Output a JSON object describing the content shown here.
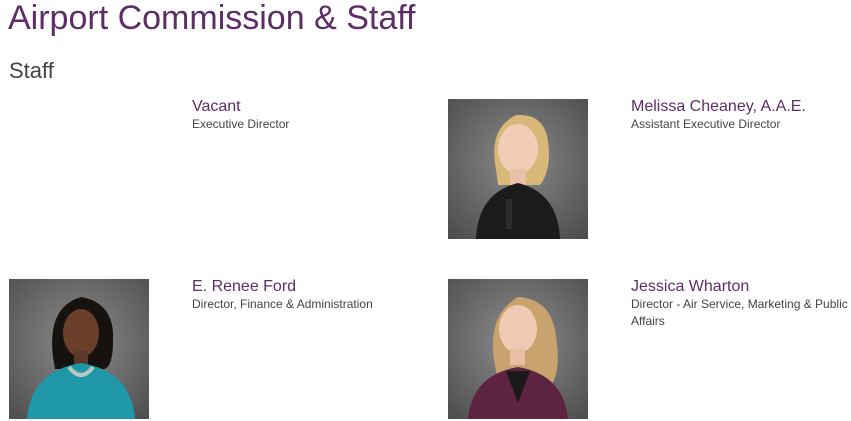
{
  "page": {
    "title": "Airport Commission & Staff",
    "section_title": "Staff"
  },
  "staff": [
    {
      "name": "Vacant",
      "title": "Executive Director",
      "has_photo": false
    },
    {
      "name": "Melissa Cheaney, A.A.E.",
      "title": "Assistant Executive Director",
      "has_photo": true
    },
    {
      "name": "E. Renee Ford",
      "title": "Director, Finance & Administration",
      "has_photo": true
    },
    {
      "name": "Jessica Wharton",
      "title": "Director - Air Service, Marketing & Public Affairs",
      "has_photo": true
    }
  ],
  "colors": {
    "heading": "#5e2d67",
    "body_text": "#444444",
    "photo_backdrop": "#6b6b6b"
  }
}
